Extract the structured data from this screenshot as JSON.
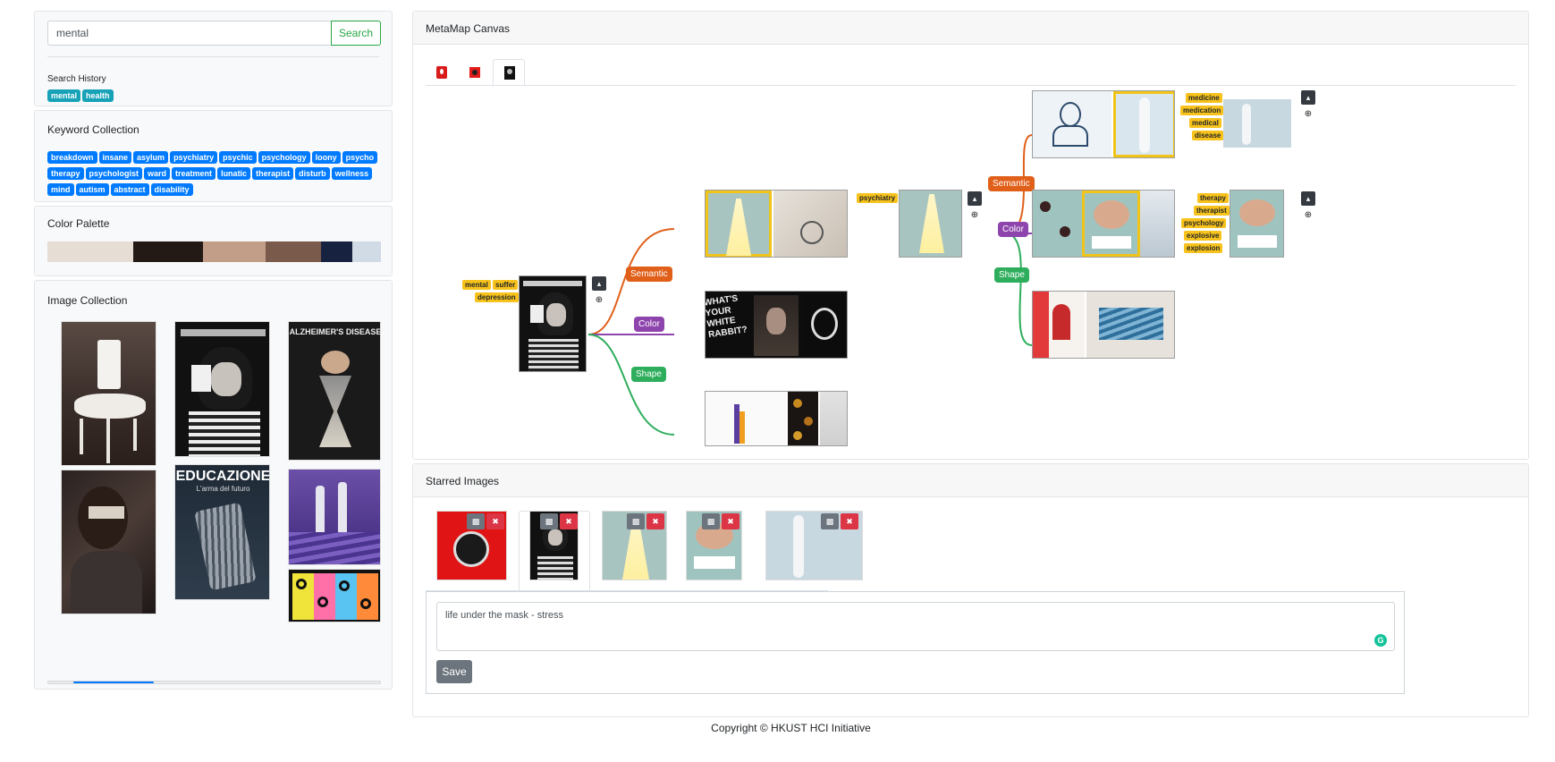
{
  "search": {
    "value": "mental",
    "button_label": "Search",
    "history_label": "Search History",
    "history": [
      "mental",
      "health"
    ]
  },
  "keywords": {
    "title": "Keyword Collection",
    "items": [
      "breakdown",
      "insane",
      "asylum",
      "psychiatry",
      "psychic",
      "psychology",
      "loony",
      "psycho",
      "therapy",
      "psychologist",
      "ward",
      "treatment",
      "lunatic",
      "therapist",
      "disturb",
      "wellness",
      "mind",
      "autism",
      "abstract",
      "disability"
    ]
  },
  "palette": {
    "title": "Color Palette",
    "colors": [
      "#e6ddd5",
      "#231a16",
      "#c29e89",
      "#7a5a4a",
      "#172240",
      "#d1dbe6"
    ]
  },
  "image_collection": {
    "title": "Image Collection",
    "poster_texts": {
      "alzheimers": "ALZHEIMER'S DISEASE",
      "educazione": "EDUCAZIONE",
      "educazione_sub": "L'arma del futuro"
    }
  },
  "canvas": {
    "title": "MetaMap Canvas",
    "relations": {
      "semantic": "Semantic",
      "color": "Color",
      "shape": "Shape"
    },
    "root_tags": [
      "mental",
      "suffer",
      "depression"
    ],
    "psychiatry_tag": "psychiatry",
    "top_tags": [
      "medicine",
      "medication",
      "medical",
      "disease"
    ],
    "mid_tags": [
      "therapy",
      "therapist",
      "psychology",
      "explosive",
      "explosion"
    ],
    "rabbit_text": "WHAT'S YOUR WHITE RABBIT?"
  },
  "starred": {
    "title": "Starred Images",
    "comment": "life under the mask - stress",
    "save_label": "Save"
  },
  "footer": "Copyright © HKUST HCI Initiative"
}
